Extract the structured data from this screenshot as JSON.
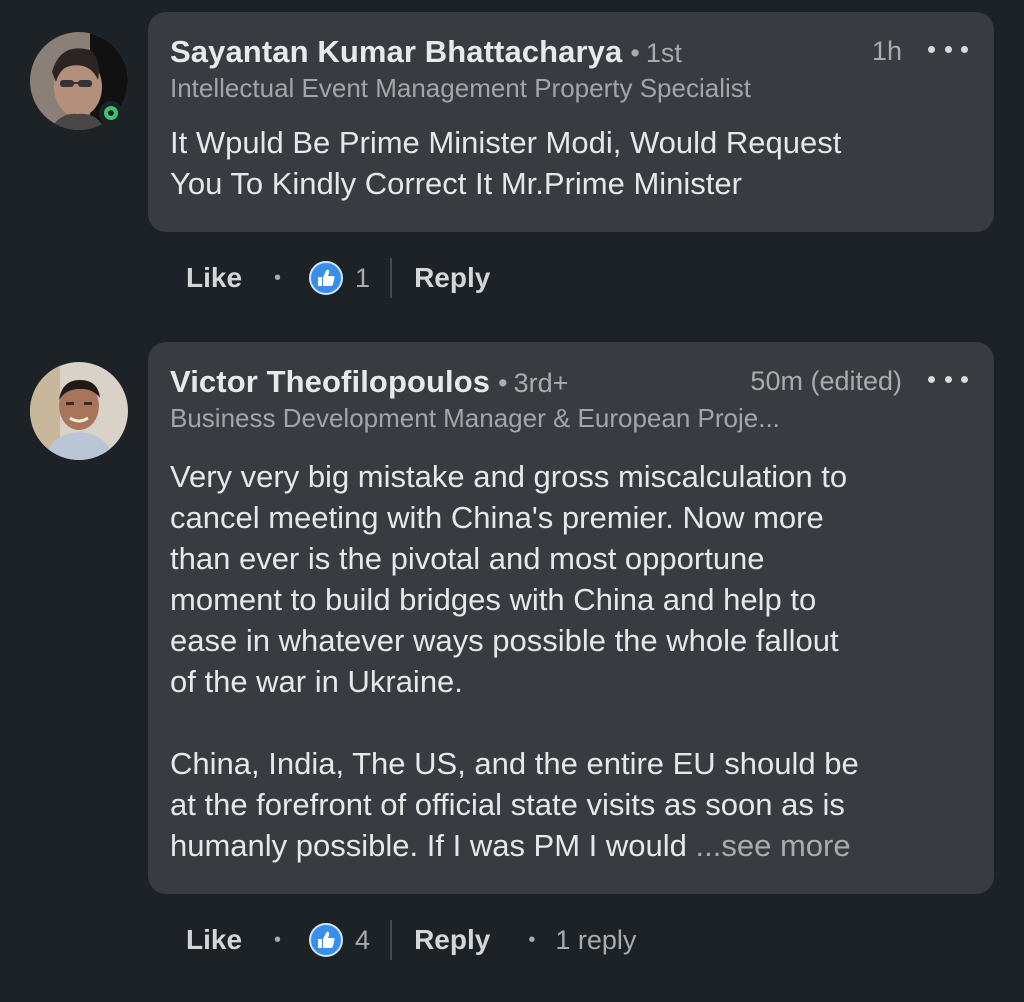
{
  "comments": [
    {
      "author": "Sayantan Kumar Bhattacharya",
      "degree": "1st",
      "time": "1h",
      "headline": "Intellectual Event Management Property Specialist",
      "body": "It Wpuld Be Prime Minister Modi, Would Request\nYou To Kindly Correct It Mr.Prime Minister",
      "online": true,
      "actions": {
        "like_label": "Like",
        "reaction_count": "1",
        "reply_label": "Reply"
      }
    },
    {
      "author": "Victor Theofilopoulos",
      "degree": "3rd+",
      "time": "50m (edited)",
      "headline": "Business Development Manager & European Proje...",
      "body": "Very very big mistake and gross miscalculation to\ncancel meeting with China's premier. Now more\nthan ever is the pivotal and most opportune\nmoment to build bridges with China and help to\nease in whatever ways possible the whole fallout\nof the war in Ukraine.\n\nChina, India, The US, and the entire EU should be\nat the forefront of official state visits as soon as is\nhumanly possible. If I was PM I would  ",
      "see_more": "...see more",
      "online": false,
      "actions": {
        "like_label": "Like",
        "reaction_count": "4",
        "reply_label": "Reply",
        "replies_label": "1 reply"
      }
    }
  ],
  "separator": "•",
  "colors": {
    "background": "#1d2226",
    "bubble": "#383c40",
    "like_blue": "#378fe9",
    "online_green": "#3ec46d"
  },
  "icons": {
    "more": "more-horizontal-icon",
    "reaction": "thumbs-up-icon",
    "online": "online-status-icon"
  }
}
